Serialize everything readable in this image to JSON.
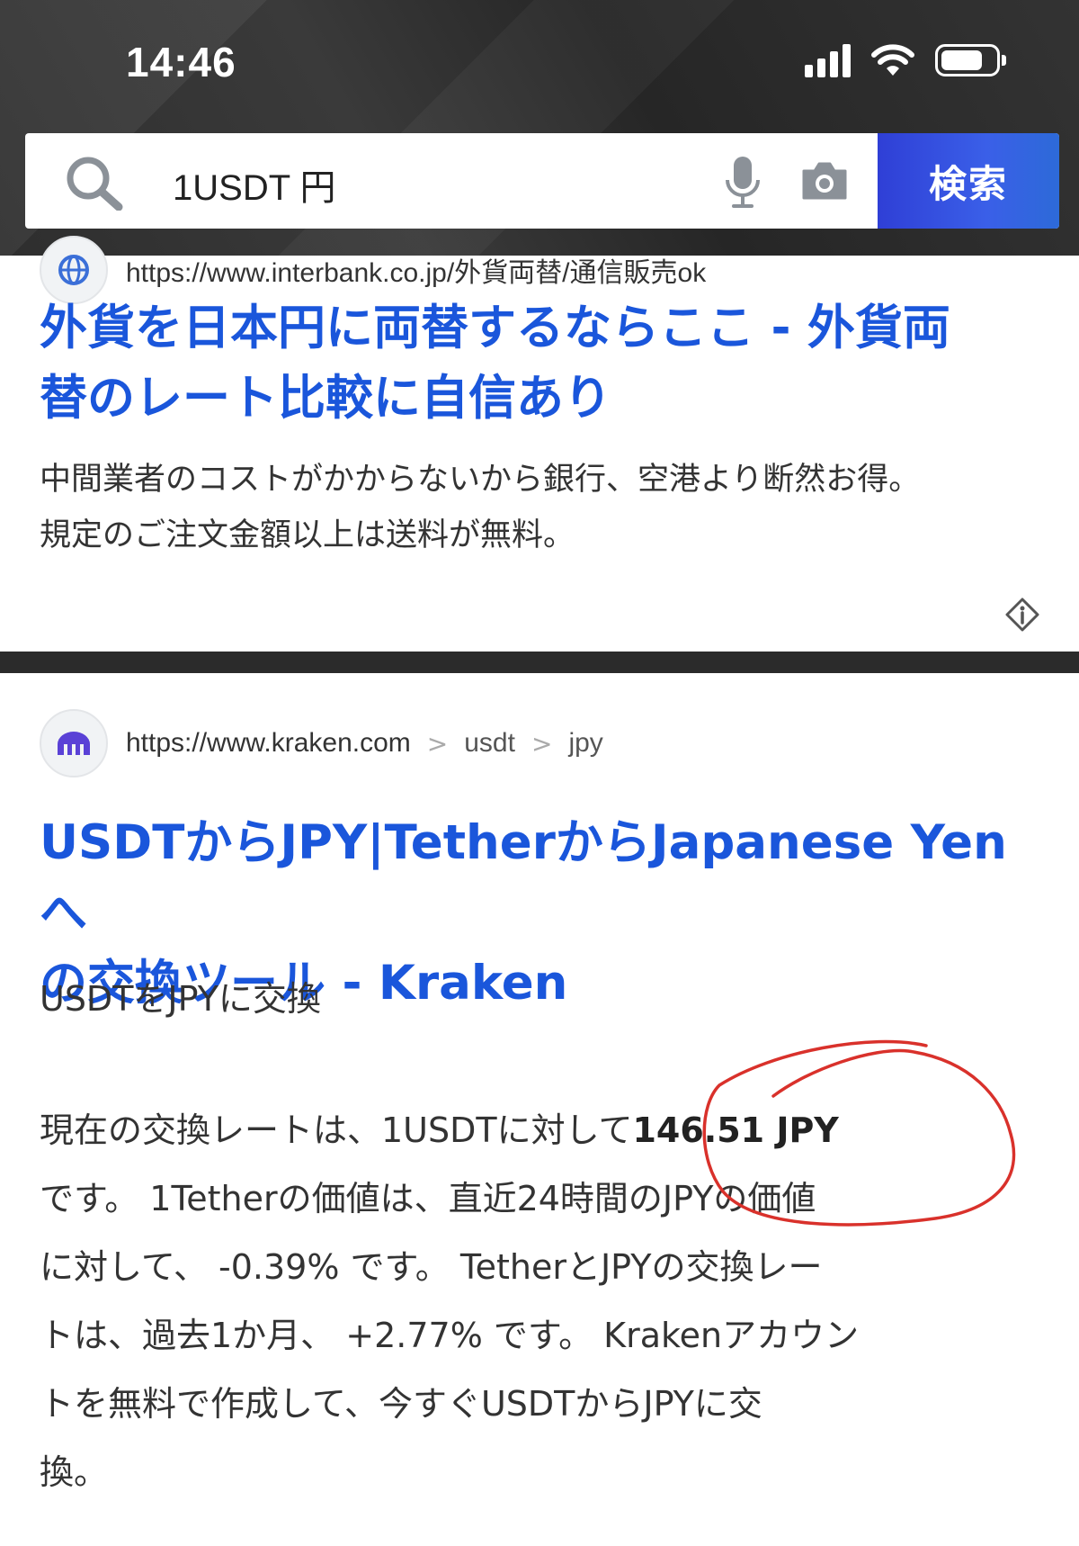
{
  "status_bar": {
    "time": "14:46"
  },
  "search": {
    "query": "1USDT 円",
    "button_label": "検索"
  },
  "result1": {
    "url": "https://www.interbank.co.jp/外貨両替/通信販売ok",
    "title_line1": "外貨を日本円に両替するならここ - 外貨両",
    "title_line2": "替のレート比較に自信あり",
    "desc_line1": "中間業者のコストがかからないから銀行、空港より断然お得。",
    "desc_line2": "規定のご注文金額以上は送料が無料。"
  },
  "result2": {
    "url": "https://www.kraken.com",
    "crumb1": "usdt",
    "crumb2": "jpy",
    "title_line1": "USDTからJPY|TetherからJapanese Yenへ",
    "title_line2": "の交換ツール - Kraken",
    "subheading": "USDTをJPYに交換",
    "body_pre": "現在の交換レートは、1USDTに対して",
    "rate": "146.51 JPY",
    "body_line2": "です。 1Tetherの価値は、直近24時間のJPYの価値",
    "body_line3": "に対して、 -0.39% です。 TetherとJPYの交換レー",
    "body_line4": "トは、過去1か月、 +2.77% です。 Krakenアカウン",
    "body_line5": "トを無料で作成して、今すぐUSDTからJPYに交",
    "body_line6": "換。"
  },
  "colors": {
    "link_blue": "#1a56db",
    "search_button": "#2f3fd6",
    "annotation_red": "#d9312b"
  },
  "icons": [
    "search-icon",
    "microphone-icon",
    "camera-icon",
    "globe-icon",
    "kraken-logo-icon",
    "info-icon"
  ]
}
